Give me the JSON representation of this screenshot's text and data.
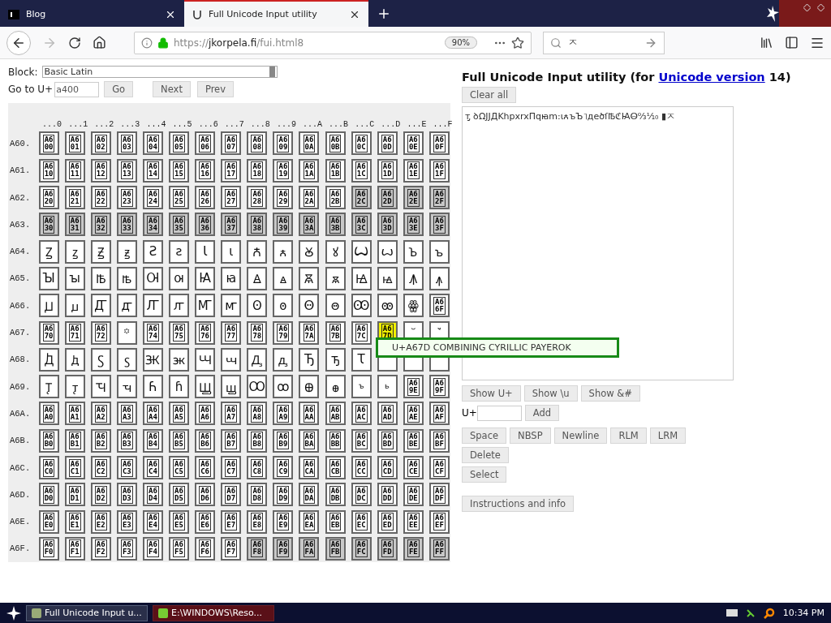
{
  "browser": {
    "tabs": [
      {
        "title": "Blog",
        "selected": false
      },
      {
        "title": "Full Unicode Input utility",
        "selected": true
      }
    ],
    "address": {
      "scheme": "https://",
      "domain": "jkorpela.fi",
      "path": "/fui.html8",
      "zoom": "90%"
    },
    "search": {
      "value": "ㅈ"
    }
  },
  "block": {
    "label": "Block:",
    "value": "Basic Latin"
  },
  "goto": {
    "label": "Go to U+",
    "value": "a400",
    "buttons": [
      "Go",
      "Next",
      "Prev"
    ]
  },
  "grid": {
    "columns": [
      "...0",
      "...1",
      "...2",
      "...3",
      "...4",
      "...5",
      "...6",
      "...7",
      "...8",
      "...9",
      "...A",
      "...B",
      "...C",
      "...D",
      "...E",
      "...F"
    ],
    "rows": [
      {
        "label": "A60.",
        "cells": [
          {
            "code": "A600",
            "unassigned": false,
            "selected": false
          },
          {
            "code": "A601",
            "unassigned": false,
            "selected": false
          },
          {
            "code": "A602",
            "unassigned": false,
            "selected": false
          },
          {
            "code": "A603",
            "unassigned": false,
            "selected": false
          },
          {
            "code": "A604",
            "unassigned": false,
            "selected": false
          },
          {
            "code": "A605",
            "unassigned": false,
            "selected": false
          },
          {
            "code": "A606",
            "unassigned": false,
            "selected": false
          },
          {
            "code": "A607",
            "unassigned": false,
            "selected": false
          },
          {
            "code": "A608",
            "unassigned": false,
            "selected": false
          },
          {
            "code": "A609",
            "unassigned": false,
            "selected": false
          },
          {
            "code": "A60A",
            "unassigned": false,
            "selected": false
          },
          {
            "code": "A60B",
            "unassigned": false,
            "selected": false
          },
          {
            "code": "A60C",
            "unassigned": false,
            "selected": false
          },
          {
            "code": "A60D",
            "unassigned": false,
            "selected": false
          },
          {
            "code": "A60E",
            "unassigned": false,
            "selected": false
          },
          {
            "code": "A60F",
            "unassigned": false,
            "selected": false
          }
        ]
      },
      {
        "label": "A61.",
        "cells": [
          {
            "code": "A610",
            "unassigned": false,
            "selected": false
          },
          {
            "code": "A611",
            "unassigned": false,
            "selected": false
          },
          {
            "code": "A612",
            "unassigned": false,
            "selected": false
          },
          {
            "code": "A613",
            "unassigned": false,
            "selected": false
          },
          {
            "code": "A614",
            "unassigned": false,
            "selected": false
          },
          {
            "code": "A615",
            "unassigned": false,
            "selected": false
          },
          {
            "code": "A616",
            "unassigned": false,
            "selected": false
          },
          {
            "code": "A617",
            "unassigned": false,
            "selected": false
          },
          {
            "code": "A618",
            "unassigned": false,
            "selected": false
          },
          {
            "code": "A619",
            "unassigned": false,
            "selected": false
          },
          {
            "code": "A61A",
            "unassigned": false,
            "selected": false
          },
          {
            "code": "A61B",
            "unassigned": false,
            "selected": false
          },
          {
            "code": "A61C",
            "unassigned": false,
            "selected": false
          },
          {
            "code": "A61D",
            "unassigned": false,
            "selected": false
          },
          {
            "code": "A61E",
            "unassigned": false,
            "selected": false
          },
          {
            "code": "A61F",
            "unassigned": false,
            "selected": false
          }
        ]
      },
      {
        "label": "A62.",
        "cells": [
          {
            "code": "A620",
            "unassigned": false,
            "selected": false
          },
          {
            "code": "A621",
            "unassigned": false,
            "selected": false
          },
          {
            "code": "A622",
            "unassigned": false,
            "selected": false
          },
          {
            "code": "A623",
            "unassigned": false,
            "selected": false
          },
          {
            "code": "A624",
            "unassigned": false,
            "selected": false
          },
          {
            "code": "A625",
            "unassigned": false,
            "selected": false
          },
          {
            "code": "A626",
            "unassigned": false,
            "selected": false
          },
          {
            "code": "A627",
            "unassigned": false,
            "selected": false
          },
          {
            "code": "A628",
            "unassigned": false,
            "selected": false
          },
          {
            "code": "A629",
            "unassigned": false,
            "selected": false
          },
          {
            "code": "A62A",
            "unassigned": false,
            "selected": false
          },
          {
            "code": "A62B",
            "unassigned": false,
            "selected": false
          },
          {
            "code": "A62C",
            "unassigned": true,
            "selected": false
          },
          {
            "code": "A62D",
            "unassigned": true,
            "selected": false
          },
          {
            "code": "A62E",
            "unassigned": true,
            "selected": false
          },
          {
            "code": "A62F",
            "unassigned": true,
            "selected": false
          }
        ]
      },
      {
        "label": "A63.",
        "cells": [
          {
            "code": "A630",
            "unassigned": true,
            "selected": false
          },
          {
            "code": "A631",
            "unassigned": true,
            "selected": false
          },
          {
            "code": "A632",
            "unassigned": true,
            "selected": false
          },
          {
            "code": "A633",
            "unassigned": true,
            "selected": false
          },
          {
            "code": "A634",
            "unassigned": true,
            "selected": false
          },
          {
            "code": "A635",
            "unassigned": true,
            "selected": false
          },
          {
            "code": "A636",
            "unassigned": true,
            "selected": false
          },
          {
            "code": "A637",
            "unassigned": true,
            "selected": false
          },
          {
            "code": "A638",
            "unassigned": true,
            "selected": false
          },
          {
            "code": "A639",
            "unassigned": true,
            "selected": false
          },
          {
            "code": "A63A",
            "unassigned": true,
            "selected": false
          },
          {
            "code": "A63B",
            "unassigned": true,
            "selected": false
          },
          {
            "code": "A63C",
            "unassigned": true,
            "selected": false
          },
          {
            "code": "A63D",
            "unassigned": true,
            "selected": false
          },
          {
            "code": "A63E",
            "unassigned": true,
            "selected": false
          },
          {
            "code": "A63F",
            "unassigned": true,
            "selected": false
          }
        ]
      },
      {
        "label": "A64.",
        "cells": [
          {
            "char": "Ꙁ",
            "unassigned": false,
            "selected": false
          },
          {
            "char": "ꙁ",
            "unassigned": false,
            "selected": false
          },
          {
            "char": "Ꙃ",
            "unassigned": false,
            "selected": false
          },
          {
            "char": "ꙃ",
            "unassigned": false,
            "selected": false
          },
          {
            "char": "Ꙅ",
            "unassigned": false,
            "selected": false
          },
          {
            "char": "ꙅ",
            "unassigned": false,
            "selected": false
          },
          {
            "char": "Ꙇ",
            "unassigned": false,
            "selected": false
          },
          {
            "char": "ꙇ",
            "unassigned": false,
            "selected": false
          },
          {
            "char": "Ꙉ",
            "unassigned": false,
            "selected": false
          },
          {
            "char": "ꙉ",
            "unassigned": false,
            "selected": false
          },
          {
            "char": "Ꙋ",
            "unassigned": false,
            "selected": false
          },
          {
            "char": "ꙋ",
            "unassigned": false,
            "selected": false
          },
          {
            "char": "Ꙍ",
            "unassigned": false,
            "selected": false
          },
          {
            "char": "ꙍ",
            "unassigned": false,
            "selected": false
          },
          {
            "char": "Ꙏ",
            "unassigned": false,
            "selected": false
          },
          {
            "char": "ꙏ",
            "unassigned": false,
            "selected": false
          }
        ]
      },
      {
        "label": "A65.",
        "cells": [
          {
            "char": "Ꙑ",
            "unassigned": false,
            "selected": false
          },
          {
            "char": "ꙑ",
            "unassigned": false,
            "selected": false
          },
          {
            "char": "Ꙓ",
            "unassigned": false,
            "selected": false
          },
          {
            "char": "ꙓ",
            "unassigned": false,
            "selected": false
          },
          {
            "char": "Ꙕ",
            "unassigned": false,
            "selected": false
          },
          {
            "char": "ꙕ",
            "unassigned": false,
            "selected": false
          },
          {
            "char": "Ꙗ",
            "unassigned": false,
            "selected": false
          },
          {
            "char": "ꙗ",
            "unassigned": false,
            "selected": false
          },
          {
            "char": "Ꙙ",
            "unassigned": false,
            "selected": false
          },
          {
            "char": "ꙙ",
            "unassigned": false,
            "selected": false
          },
          {
            "char": "Ꙛ",
            "unassigned": false,
            "selected": false
          },
          {
            "char": "ꙛ",
            "unassigned": false,
            "selected": false
          },
          {
            "char": "Ꙝ",
            "unassigned": false,
            "selected": false
          },
          {
            "char": "ꙝ",
            "unassigned": false,
            "selected": false
          },
          {
            "char": "Ꙟ",
            "unassigned": false,
            "selected": false
          },
          {
            "char": "ꙟ",
            "unassigned": false,
            "selected": false
          }
        ]
      },
      {
        "label": "A66.",
        "cells": [
          {
            "char": "Ꙡ",
            "unassigned": false,
            "selected": false
          },
          {
            "char": "ꙡ",
            "unassigned": false,
            "selected": false
          },
          {
            "char": "Ꙣ",
            "unassigned": false,
            "selected": false
          },
          {
            "char": "ꙣ",
            "unassigned": false,
            "selected": false
          },
          {
            "char": "Ꙥ",
            "unassigned": false,
            "selected": false
          },
          {
            "char": "ꙥ",
            "unassigned": false,
            "selected": false
          },
          {
            "char": "Ꙧ",
            "unassigned": false,
            "selected": false
          },
          {
            "char": "ꙧ",
            "unassigned": false,
            "selected": false
          },
          {
            "char": "Ꙩ",
            "unassigned": false,
            "selected": false
          },
          {
            "char": "ꙩ",
            "unassigned": false,
            "selected": false
          },
          {
            "char": "Ꙫ",
            "unassigned": false,
            "selected": false
          },
          {
            "char": "ꙫ",
            "unassigned": false,
            "selected": false
          },
          {
            "char": "Ꙭ",
            "unassigned": false,
            "selected": false
          },
          {
            "char": "ꙭ",
            "unassigned": false,
            "selected": false
          },
          {
            "char": "ꙮ",
            "unassigned": false,
            "selected": false
          },
          {
            "code": "A66F",
            "unassigned": false,
            "selected": false
          }
        ]
      },
      {
        "label": "A67.",
        "cells": [
          {
            "code": "A670",
            "unassigned": false,
            "selected": false
          },
          {
            "code": "A671",
            "unassigned": false,
            "selected": false
          },
          {
            "code": "A672",
            "unassigned": false,
            "selected": false
          },
          {
            "char": "꙳",
            "unassigned": false,
            "selected": false
          },
          {
            "code": "A674",
            "unassigned": false,
            "selected": false
          },
          {
            "code": "A675",
            "unassigned": false,
            "selected": false
          },
          {
            "code": "A676",
            "unassigned": false,
            "selected": false
          },
          {
            "code": "A677",
            "unassigned": false,
            "selected": false
          },
          {
            "code": "A678",
            "unassigned": false,
            "selected": false
          },
          {
            "code": "A679",
            "unassigned": false,
            "selected": false
          },
          {
            "code": "A67A",
            "unassigned": false,
            "selected": false
          },
          {
            "code": "A67B",
            "unassigned": false,
            "selected": false
          },
          {
            "code": "A67C",
            "unassigned": false,
            "selected": false
          },
          {
            "code": "A67D",
            "unassigned": false,
            "selected": true
          },
          {
            "char": "꙾",
            "unassigned": false,
            "selected": false
          },
          {
            "char": "ꙿ",
            "unassigned": false,
            "selected": false
          }
        ]
      },
      {
        "label": "A68.",
        "cells": [
          {
            "char": "Ꚁ",
            "unassigned": false,
            "selected": false
          },
          {
            "char": "ꚁ",
            "unassigned": false,
            "selected": false
          },
          {
            "char": "Ꚃ",
            "unassigned": false,
            "selected": false
          },
          {
            "char": "ꚃ",
            "unassigned": false,
            "selected": false
          },
          {
            "char": "Ꚅ",
            "unassigned": false,
            "selected": false
          },
          {
            "char": "ꚅ",
            "unassigned": false,
            "selected": false
          },
          {
            "char": "Ꚇ",
            "unassigned": false,
            "selected": false
          },
          {
            "char": "ꚇ",
            "unassigned": false,
            "selected": false
          },
          {
            "char": "Ꚉ",
            "unassigned": false,
            "selected": false
          },
          {
            "char": "ꚉ",
            "unassigned": false,
            "selected": false
          },
          {
            "char": "Ꚋ",
            "unassigned": false,
            "selected": false
          },
          {
            "char": "ꚋ",
            "unassigned": false,
            "selected": false
          },
          {
            "char": "Ꚍ",
            "unassigned": false,
            "selected": false
          },
          {
            "unassigned": false,
            "selected": false
          },
          {
            "unassigned": false,
            "selected": false
          },
          {
            "unassigned": false,
            "selected": false
          }
        ]
      },
      {
        "label": "A69.",
        "cells": [
          {
            "char": "Ꚑ",
            "unassigned": false,
            "selected": false
          },
          {
            "char": "ꚑ",
            "unassigned": false,
            "selected": false
          },
          {
            "char": "Ꚓ",
            "unassigned": false,
            "selected": false
          },
          {
            "char": "ꚓ",
            "unassigned": false,
            "selected": false
          },
          {
            "char": "Ꚕ",
            "unassigned": false,
            "selected": false
          },
          {
            "char": "ꚕ",
            "unassigned": false,
            "selected": false
          },
          {
            "char": "Ꚗ",
            "unassigned": false,
            "selected": false
          },
          {
            "char": "ꚗ",
            "unassigned": false,
            "selected": false
          },
          {
            "char": "Ꚙ",
            "unassigned": false,
            "selected": false
          },
          {
            "char": "ꚙ",
            "unassigned": false,
            "selected": false
          },
          {
            "char": "Ꚛ",
            "unassigned": false,
            "selected": false
          },
          {
            "char": "ꚛ",
            "unassigned": false,
            "selected": false
          },
          {
            "char": "ꚜ",
            "unassigned": false,
            "selected": false
          },
          {
            "char": "ꚝ",
            "unassigned": false,
            "selected": false
          },
          {
            "code": "A69E",
            "unassigned": false,
            "selected": false
          },
          {
            "code": "A69F",
            "unassigned": false,
            "selected": false
          }
        ]
      },
      {
        "label": "A6A.",
        "cells": [
          {
            "code": "A6A0",
            "unassigned": false,
            "selected": false
          },
          {
            "code": "A6A1",
            "unassigned": false,
            "selected": false
          },
          {
            "code": "A6A2",
            "unassigned": false,
            "selected": false
          },
          {
            "code": "A6A3",
            "unassigned": false,
            "selected": false
          },
          {
            "code": "A6A4",
            "unassigned": false,
            "selected": false
          },
          {
            "code": "A6A5",
            "unassigned": false,
            "selected": false
          },
          {
            "code": "A6A6",
            "unassigned": false,
            "selected": false
          },
          {
            "code": "A6A7",
            "unassigned": false,
            "selected": false
          },
          {
            "code": "A6A8",
            "unassigned": false,
            "selected": false
          },
          {
            "code": "A6A9",
            "unassigned": false,
            "selected": false
          },
          {
            "code": "A6AA",
            "unassigned": false,
            "selected": false
          },
          {
            "code": "A6AB",
            "unassigned": false,
            "selected": false
          },
          {
            "code": "A6AC",
            "unassigned": false,
            "selected": false
          },
          {
            "code": "A6AD",
            "unassigned": false,
            "selected": false
          },
          {
            "code": "A6AE",
            "unassigned": false,
            "selected": false
          },
          {
            "code": "A6AF",
            "unassigned": false,
            "selected": false
          }
        ]
      },
      {
        "label": "A6B.",
        "cells": [
          {
            "code": "A6B0",
            "unassigned": false,
            "selected": false
          },
          {
            "code": "A6B1",
            "unassigned": false,
            "selected": false
          },
          {
            "code": "A6B2",
            "unassigned": false,
            "selected": false
          },
          {
            "code": "A6B3",
            "unassigned": false,
            "selected": false
          },
          {
            "code": "A6B4",
            "unassigned": false,
            "selected": false
          },
          {
            "code": "A6B5",
            "unassigned": false,
            "selected": false
          },
          {
            "code": "A6B6",
            "unassigned": false,
            "selected": false
          },
          {
            "code": "A6B7",
            "unassigned": false,
            "selected": false
          },
          {
            "code": "A6B8",
            "unassigned": false,
            "selected": false
          },
          {
            "code": "A6B9",
            "unassigned": false,
            "selected": false
          },
          {
            "code": "A6BA",
            "unassigned": false,
            "selected": false
          },
          {
            "code": "A6BB",
            "unassigned": false,
            "selected": false
          },
          {
            "code": "A6BC",
            "unassigned": false,
            "selected": false
          },
          {
            "code": "A6BD",
            "unassigned": false,
            "selected": false
          },
          {
            "code": "A6BE",
            "unassigned": false,
            "selected": false
          },
          {
            "code": "A6BF",
            "unassigned": false,
            "selected": false
          }
        ]
      },
      {
        "label": "A6C.",
        "cells": [
          {
            "code": "A6C0",
            "unassigned": false,
            "selected": false
          },
          {
            "code": "A6C1",
            "unassigned": false,
            "selected": false
          },
          {
            "code": "A6C2",
            "unassigned": false,
            "selected": false
          },
          {
            "code": "A6C3",
            "unassigned": false,
            "selected": false
          },
          {
            "code": "A6C4",
            "unassigned": false,
            "selected": false
          },
          {
            "code": "A6C5",
            "unassigned": false,
            "selected": false
          },
          {
            "code": "A6C6",
            "unassigned": false,
            "selected": false
          },
          {
            "code": "A6C7",
            "unassigned": false,
            "selected": false
          },
          {
            "code": "A6C8",
            "unassigned": false,
            "selected": false
          },
          {
            "code": "A6C9",
            "unassigned": false,
            "selected": false
          },
          {
            "code": "A6CA",
            "unassigned": false,
            "selected": false
          },
          {
            "code": "A6CB",
            "unassigned": false,
            "selected": false
          },
          {
            "code": "A6CC",
            "unassigned": false,
            "selected": false
          },
          {
            "code": "A6CD",
            "unassigned": false,
            "selected": false
          },
          {
            "code": "A6CE",
            "unassigned": false,
            "selected": false
          },
          {
            "code": "A6CF",
            "unassigned": false,
            "selected": false
          }
        ]
      },
      {
        "label": "A6D.",
        "cells": [
          {
            "code": "A6D0",
            "unassigned": false,
            "selected": false
          },
          {
            "code": "A6D1",
            "unassigned": false,
            "selected": false
          },
          {
            "code": "A6D2",
            "unassigned": false,
            "selected": false
          },
          {
            "code": "A6D3",
            "unassigned": false,
            "selected": false
          },
          {
            "code": "A6D4",
            "unassigned": false,
            "selected": false
          },
          {
            "code": "A6D5",
            "unassigned": false,
            "selected": false
          },
          {
            "code": "A6D6",
            "unassigned": false,
            "selected": false
          },
          {
            "code": "A6D7",
            "unassigned": false,
            "selected": false
          },
          {
            "code": "A6D8",
            "unassigned": false,
            "selected": false
          },
          {
            "code": "A6D9",
            "unassigned": false,
            "selected": false
          },
          {
            "code": "A6DA",
            "unassigned": false,
            "selected": false
          },
          {
            "code": "A6DB",
            "unassigned": false,
            "selected": false
          },
          {
            "code": "A6DC",
            "unassigned": false,
            "selected": false
          },
          {
            "code": "A6DD",
            "unassigned": false,
            "selected": false
          },
          {
            "code": "A6DE",
            "unassigned": false,
            "selected": false
          },
          {
            "code": "A6DF",
            "unassigned": false,
            "selected": false
          }
        ]
      },
      {
        "label": "A6E.",
        "cells": [
          {
            "code": "A6E0",
            "unassigned": false,
            "selected": false
          },
          {
            "code": "A6E1",
            "unassigned": false,
            "selected": false
          },
          {
            "code": "A6E2",
            "unassigned": false,
            "selected": false
          },
          {
            "code": "A6E3",
            "unassigned": false,
            "selected": false
          },
          {
            "code": "A6E4",
            "unassigned": false,
            "selected": false
          },
          {
            "code": "A6E5",
            "unassigned": false,
            "selected": false
          },
          {
            "code": "A6E6",
            "unassigned": false,
            "selected": false
          },
          {
            "code": "A6E7",
            "unassigned": false,
            "selected": false
          },
          {
            "code": "A6E8",
            "unassigned": false,
            "selected": false
          },
          {
            "code": "A6E9",
            "unassigned": false,
            "selected": false
          },
          {
            "code": "A6EA",
            "unassigned": false,
            "selected": false
          },
          {
            "code": "A6EB",
            "unassigned": false,
            "selected": false
          },
          {
            "code": "A6EC",
            "unassigned": false,
            "selected": false
          },
          {
            "code": "A6ED",
            "unassigned": false,
            "selected": false
          },
          {
            "code": "A6EE",
            "unassigned": false,
            "selected": false
          },
          {
            "code": "A6EF",
            "unassigned": false,
            "selected": false
          }
        ]
      },
      {
        "label": "A6F.",
        "cells": [
          {
            "code": "A6F0",
            "unassigned": false,
            "selected": false
          },
          {
            "code": "A6F1",
            "unassigned": false,
            "selected": false
          },
          {
            "code": "A6F2",
            "unassigned": false,
            "selected": false
          },
          {
            "code": "A6F3",
            "unassigned": false,
            "selected": false
          },
          {
            "code": "A6F4",
            "unassigned": false,
            "selected": false
          },
          {
            "code": "A6F5",
            "unassigned": false,
            "selected": false
          },
          {
            "code": "A6F6",
            "unassigned": false,
            "selected": false
          },
          {
            "code": "A6F7",
            "unassigned": false,
            "selected": false
          },
          {
            "code": "A6F8",
            "unassigned": true,
            "selected": false
          },
          {
            "code": "A6F9",
            "unassigned": true,
            "selected": false
          },
          {
            "code": "A6FA",
            "unassigned": true,
            "selected": false
          },
          {
            "code": "A6FB",
            "unassigned": true,
            "selected": false
          },
          {
            "code": "A6FC",
            "unassigned": true,
            "selected": false
          },
          {
            "code": "A6FD",
            "unassigned": true,
            "selected": false
          },
          {
            "code": "A6FE",
            "unassigned": true,
            "selected": false
          },
          {
            "code": "A6FF",
            "unassigned": true,
            "selected": false
          }
        ]
      }
    ]
  },
  "tooltip": "U+A67D COMBINING CYRILLIC PAYEROK",
  "heading": {
    "before": "Full Unicode Input utility (for ",
    "link": "Unicode version",
    "after": " 14)"
  },
  "clear_button": "Clear all",
  "output": "ᴛ̡ ꝺΩJJДKհpxrxΠqꙗm꞉ꙇꙉъЪ˥дeծſꙒℭꙖꙪ⁰⁄₃¹⁄₁₀ ▮ㅈ",
  "show_buttons": [
    "Show U+",
    "Show \\u",
    "Show &#"
  ],
  "add": {
    "label": "U+",
    "button": "Add"
  },
  "insert_buttons": [
    "Space",
    "NBSP",
    "Newline",
    "RLM",
    "LRM"
  ],
  "edit_buttons": [
    "Delete",
    "Select"
  ],
  "info_button": "Instructions and info",
  "taskbar": {
    "tasks": [
      {
        "title": "Full Unicode Input u...",
        "selected": true
      },
      {
        "title": "E:\\WINDOWS\\Reso...",
        "selected": false
      }
    ],
    "clock": "10:34 PM"
  }
}
